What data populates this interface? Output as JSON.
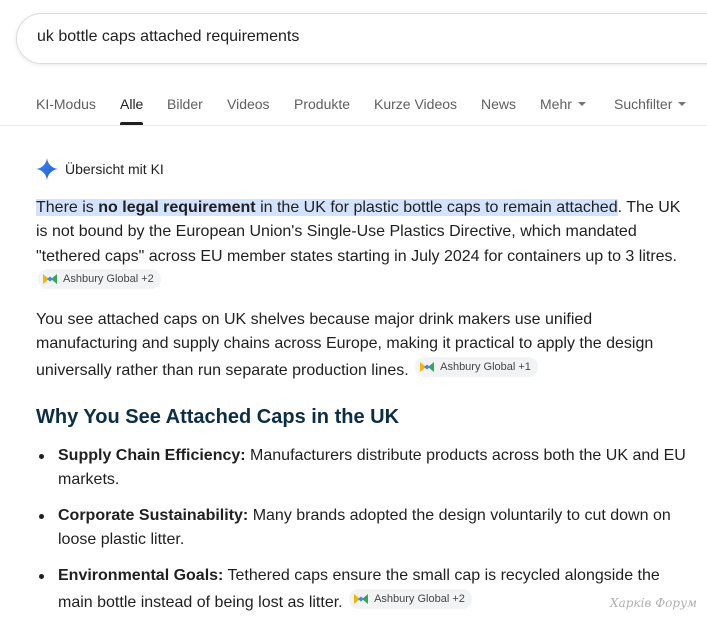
{
  "search": {
    "query": "uk bottle caps attached requirements"
  },
  "tabs": [
    {
      "label": "KI-Modus"
    },
    {
      "label": "Alle"
    },
    {
      "label": "Bilder"
    },
    {
      "label": "Videos"
    },
    {
      "label": "Produkte"
    },
    {
      "label": "Kurze Videos"
    },
    {
      "label": "News"
    },
    {
      "label": "Mehr"
    },
    {
      "label": "Suchfilter"
    }
  ],
  "active_tab": "Alle",
  "overview": {
    "title": "Übersicht mit KI",
    "p1": {
      "hl_a": "There is ",
      "hl_bold": "no legal requirement",
      "hl_b": " in the UK for plastic bottle caps to remain attached",
      "rest": ". The UK is not bound by the European Union's Single-Use Plastics Directive, which mandated \"tethered caps\" across EU member states starting in July 2024 for containers up to 3 litres.",
      "source": "Ashbury Global +2"
    },
    "p2": {
      "text": "You see attached caps on UK shelves because major drink makers use unified manufacturing and supply chains across Europe, making it practical to apply the design universally rather than run separate production lines.",
      "source": "Ashbury Global +1"
    },
    "section_title": "Why You See Attached Caps in the UK",
    "bullets": [
      {
        "title": "Supply Chain Efficiency:",
        "text": " Manufacturers distribute products across both the UK and EU markets."
      },
      {
        "title": "Corporate Sustainability:",
        "text": " Many brands adopted the design voluntarily to cut down on loose plastic litter."
      },
      {
        "title": "Environmental Goals:",
        "text": " Tethered caps ensure the small cap is recycled alongside the main bottle instead of being lost as litter.",
        "source": "Ashbury Global +2"
      }
    ]
  },
  "watermark": "Харків Форум",
  "colors": {
    "highlight": "#d3e3fd",
    "heading": "#0b2e46",
    "spark_blue": "#4285f4"
  },
  "icons": {
    "ai": "gemini-spark-icon",
    "chip": "source-favicon-icon",
    "dropdown": "caret-down-icon"
  }
}
